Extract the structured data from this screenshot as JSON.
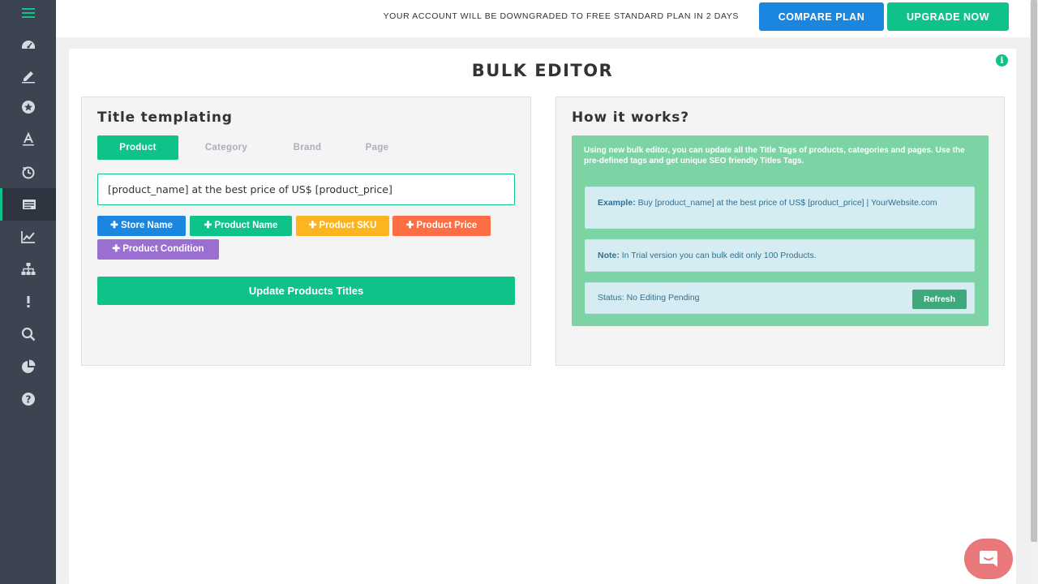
{
  "topbar": {
    "notice": "YOUR ACCOUNT WILL BE DOWNGRADED TO FREE STANDARD PLAN IN 2 DAYS",
    "compare_label": "COMPARE PLAN",
    "upgrade_label": "UPGRADE NOW"
  },
  "sidebar": {
    "items": [
      {
        "icon": "menu-icon"
      },
      {
        "icon": "dashboard-icon"
      },
      {
        "icon": "edit-icon"
      },
      {
        "icon": "star-icon"
      },
      {
        "icon": "text-icon"
      },
      {
        "icon": "history-icon"
      },
      {
        "icon": "bulk-editor-icon",
        "active": true
      },
      {
        "icon": "chart-icon"
      },
      {
        "icon": "sitemap-icon"
      },
      {
        "icon": "alert-icon"
      },
      {
        "icon": "search-icon"
      },
      {
        "icon": "pie-chart-icon"
      },
      {
        "icon": "help-icon"
      }
    ]
  },
  "page": {
    "title": "BULK EDITOR"
  },
  "templating": {
    "heading": "Title templating",
    "tabs": [
      "Product",
      "Category",
      "Brand",
      "Page"
    ],
    "active_tab": "Product",
    "template_value": "[product_name] at the best price of US$ [product_price]",
    "tags": [
      {
        "label": "Store Name",
        "color": "#1a86e0"
      },
      {
        "label": "Product Name",
        "color": "#0ec28a"
      },
      {
        "label": "Product SKU",
        "color": "#fbb51e"
      },
      {
        "label": "Product Price",
        "color": "#fd6e45"
      },
      {
        "label": "Product Condition",
        "color": "#9b6fd1"
      }
    ],
    "update_label": "Update Products Titles"
  },
  "how": {
    "heading": "How it works?",
    "intro": "Using new bulk editor, you can update all the Title Tags of products, categories and pages. Use the pre-defined tags and get unique SEO friendly Titles Tags.",
    "example_label": "Example:",
    "example_text": "Buy [product_name] at the best price of US$ [product_price] | YourWebsite.com",
    "note_label": "Note:",
    "note_text": "In Trial version you can bulk edit only 100 Products.",
    "status_text": "Status: No Editing Pending",
    "refresh_label": "Refresh"
  },
  "colors": {
    "accent": "#0ec28a",
    "primary": "#1a86e0",
    "sidebar": "#3d4451",
    "help_box": "#7cd4a4",
    "chat": "#e9787a"
  }
}
